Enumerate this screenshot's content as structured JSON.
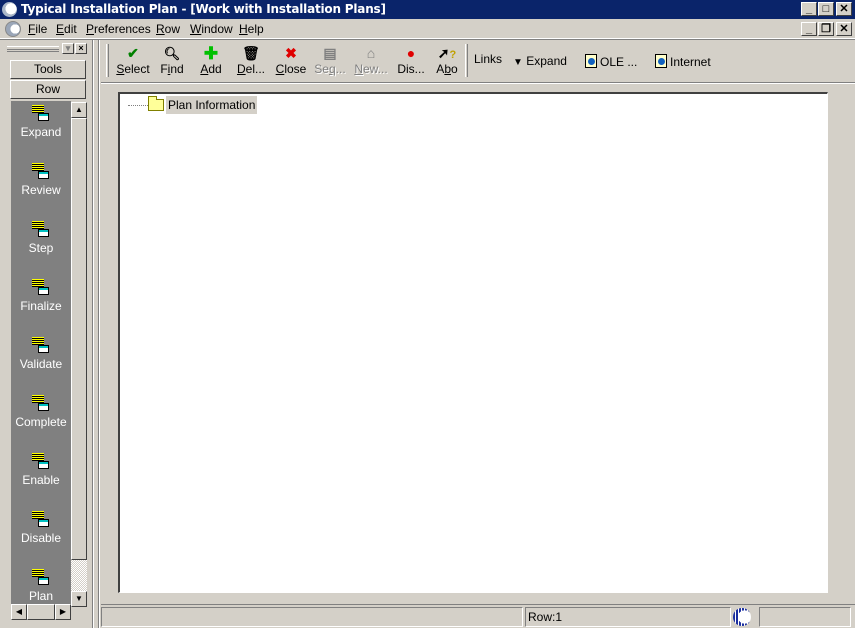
{
  "window": {
    "title": "Typical Installation Plan - [Work with Installation Plans]",
    "caption_buttons": [
      "minimize",
      "maximize",
      "close"
    ],
    "doc_caption_buttons": [
      "minimize",
      "restore",
      "close"
    ]
  },
  "menu": [
    {
      "label": "File",
      "mnemonic": "F",
      "rest": "ile"
    },
    {
      "label": "Edit",
      "mnemonic": "E",
      "rest": "dit"
    },
    {
      "label": "Preferences",
      "mnemonic": "P",
      "rest": "references"
    },
    {
      "label": "Row",
      "mnemonic": "R",
      "rest": "ow"
    },
    {
      "label": "Window",
      "mnemonic": "W",
      "rest": "indow"
    },
    {
      "label": "Help",
      "mnemonic": "H",
      "rest": "elp"
    }
  ],
  "left_panel": {
    "tabs": [
      "Tools",
      "Row"
    ],
    "items": [
      "Expand",
      "Review",
      "Step",
      "Finalize",
      "Validate",
      "Complete",
      "Enable",
      "Disable",
      "Plan"
    ]
  },
  "toolbar": {
    "buttons": [
      {
        "label": "Select",
        "icon": "checkmark-icon",
        "enabled": true
      },
      {
        "label": "Find",
        "icon": "find-icon",
        "enabled": true
      },
      {
        "label": "Add",
        "icon": "plus-icon",
        "enabled": true
      },
      {
        "label": "Del...",
        "icon": "trash-icon",
        "enabled": true
      },
      {
        "label": "Close",
        "icon": "x-icon",
        "enabled": true
      },
      {
        "label": "Seq...",
        "icon": "sequence-icon",
        "enabled": false
      },
      {
        "label": "New...",
        "icon": "new-icon",
        "enabled": false
      },
      {
        "label": "Dis...",
        "icon": "display-icon",
        "enabled": true
      },
      {
        "label": "Abo",
        "icon": "about-icon",
        "enabled": true
      }
    ],
    "links_label": "Links",
    "expand_label": "Expand",
    "ole_label": "OLE ...",
    "internet_label": "Internet"
  },
  "tree": {
    "root": "Plan Information"
  },
  "status": {
    "row": "Row:1"
  },
  "colors": {
    "titlebar": "#0a246a",
    "face": "#d4d0c8",
    "panel_dark": "#808080"
  }
}
